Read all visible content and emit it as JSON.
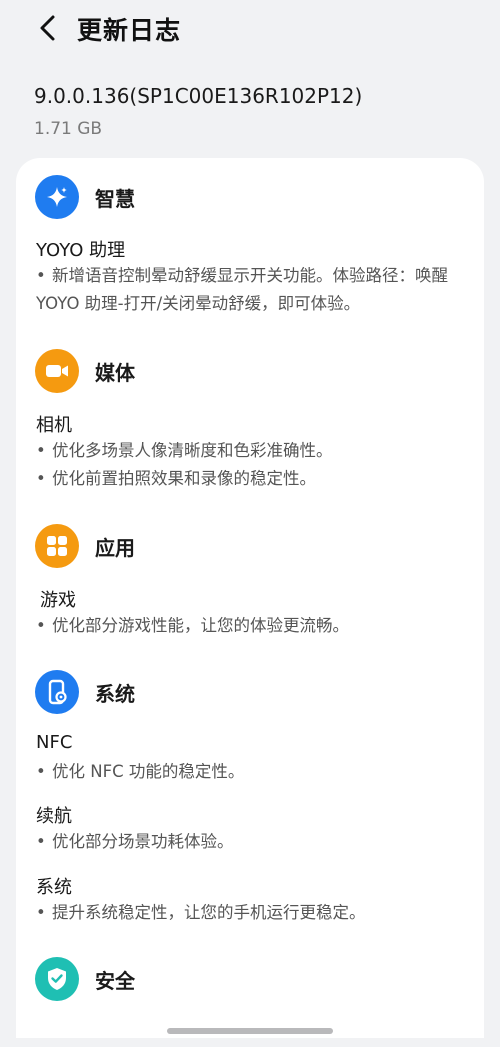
{
  "header": {
    "title": "更新日志"
  },
  "package": {
    "version": "9.0.0.136(SP1C00E136R102P12)",
    "size": "1.71 GB"
  },
  "colors": {
    "smart": "#1f7cf0",
    "media": "#f59a10",
    "apps": "#f59a10",
    "system": "#1f7cf0",
    "security": "#1fbfb3"
  },
  "sections": [
    {
      "title": "智慧",
      "icon": "sparkle-icon",
      "groups": [
        {
          "title": "YOYO 助理",
          "items": [
            "新增语音控制晕动舒缓显示开关功能。体验路径：唤醒 YOYO 助理-打开/关闭晕动舒缓，即可体验。"
          ]
        }
      ]
    },
    {
      "title": "媒体",
      "icon": "video-camera-icon",
      "groups": [
        {
          "title": "相机",
          "items": [
            "优化多场景人像清晰度和色彩准确性。",
            "优化前置拍照效果和录像的稳定性。"
          ]
        }
      ]
    },
    {
      "title": "应用",
      "icon": "app-grid-icon",
      "groups": [
        {
          "title": "游戏",
          "items": [
            "优化部分游戏性能，让您的体验更流畅。"
          ]
        }
      ]
    },
    {
      "title": "系统",
      "icon": "phone-settings-icon",
      "groups": [
        {
          "title": "NFC",
          "items": [
            "优化 NFC 功能的稳定性。"
          ]
        },
        {
          "title": "续航",
          "items": [
            "优化部分场景功耗体验。"
          ]
        },
        {
          "title": "系统",
          "items": [
            "提升系统稳定性，让您的手机运行更稳定。"
          ]
        }
      ]
    },
    {
      "title": "安全",
      "icon": "shield-check-icon",
      "groups": []
    }
  ]
}
